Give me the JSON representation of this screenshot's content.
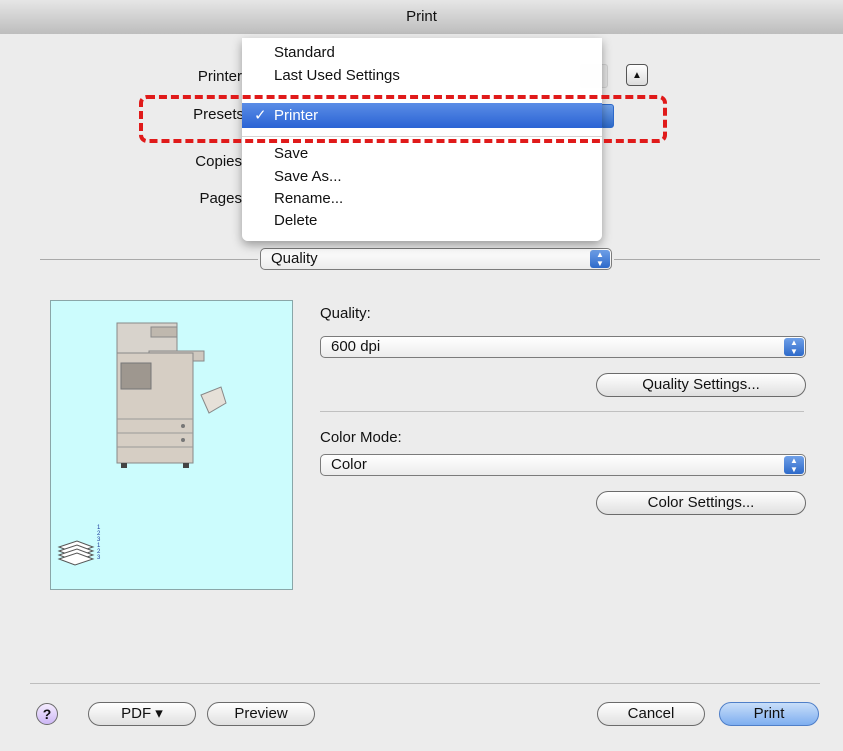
{
  "window": {
    "title": "Print"
  },
  "labels": {
    "printer": "Printer",
    "presets": "Presets",
    "copies": "Copies",
    "pages": "Pages"
  },
  "presets_menu": {
    "items_top": [
      "Standard",
      "Last Used Settings"
    ],
    "selected": "Printer",
    "check": "✓",
    "items_bottom": [
      "Save",
      "Save As...",
      "Rename...",
      "Delete"
    ]
  },
  "panel_popup": {
    "value": "Quality",
    "arrows": "▲▼"
  },
  "quality": {
    "label": "Quality:",
    "value": "600 dpi",
    "settings_button": "Quality Settings..."
  },
  "color_mode": {
    "label": "Color Mode:",
    "value": "Color",
    "settings_button": "Color Settings..."
  },
  "preview": {
    "page_numbers": "1\n2\n3\n1\n2\n3"
  },
  "bottom": {
    "help": "?",
    "pdf": "PDF ▾",
    "preview": "Preview",
    "cancel": "Cancel",
    "print": "Print"
  },
  "colors": {
    "highlight": "#2a63d4",
    "preview_bg": "#ccfcfd",
    "annotation": "#e01a1a"
  }
}
